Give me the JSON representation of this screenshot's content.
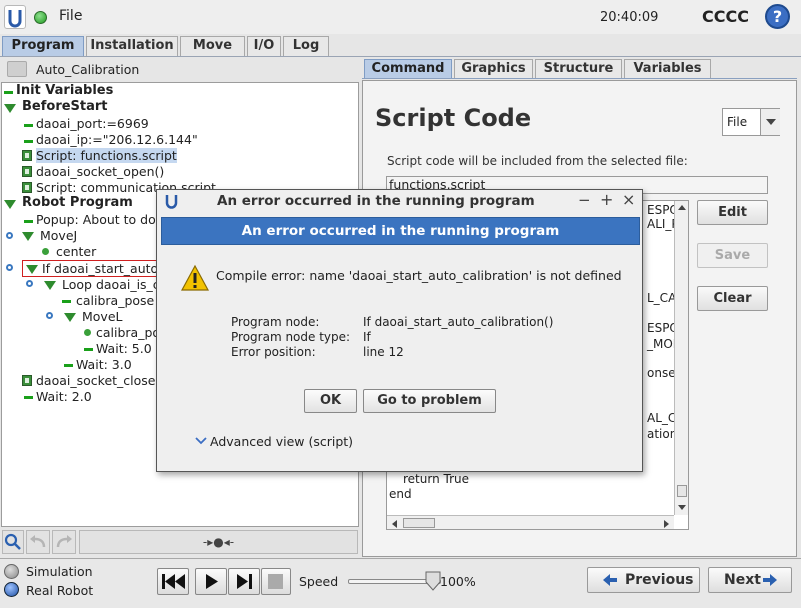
{
  "header": {
    "menu_label": "File",
    "time": "20:40:09",
    "robot_name": "CCCC",
    "help_label": "?"
  },
  "main_tabs": [
    "Program",
    "Installation",
    "Move",
    "I/O",
    "Log"
  ],
  "program_name": "Auto_Calibration",
  "tree": [
    "Init Variables",
    "BeforeStart",
    "daoai_port:=6969",
    "daoai_ip:=\"206.12.6.144\"",
    "Script: functions.script",
    "daoai_socket_open()",
    "Script: communication.script",
    "Robot Program",
    "Popup: About to do",
    "MoveJ",
    "center",
    "If daoai_start_auto",
    "Loop daoai_is_c",
    "calibra_pose",
    "MoveL",
    "calibra_po",
    "Wait: 5.0",
    "Wait: 3.0",
    "daoai_socket_close",
    "Wait: 2.0"
  ],
  "right_tabs": [
    "Command",
    "Graphics",
    "Structure",
    "Variables"
  ],
  "script_panel": {
    "title": "Script Code",
    "mode": "File",
    "info": "Script code will be included from the selected file:",
    "file": "functions.script",
    "code_fragments": [
      "ESPO",
      "ALI_P",
      "L_CA",
      "ESPO",
      "_MOD",
      "onse(",
      "AL_CA",
      "ation",
      "return True",
      "end"
    ],
    "buttons": {
      "edit": "Edit",
      "save": "Save",
      "clear": "Clear"
    }
  },
  "footer": {
    "simulation": "Simulation",
    "real_robot": "Real Robot",
    "speed_label": "Speed",
    "speed_value": "100%",
    "speed_fraction": 1.0,
    "previous": "Previous",
    "next": "Next"
  },
  "dialog": {
    "title": "An error occurred in the running program",
    "heading": "An error occurred in the running program",
    "message": "Compile error: name 'daoai_start_auto_calibration' is not defined",
    "node_label": "Program node:",
    "node_value": "If daoai_start_auto_calibration()",
    "type_label": "Program node type:",
    "type_value": "If",
    "pos_label": "Error position:",
    "pos_value": "line 12",
    "ok": "OK",
    "goto": "Go to problem",
    "advanced": "Advanced view (script)",
    "window_controls": [
      "−",
      "+",
      "×"
    ]
  },
  "tree_toolbar": {
    "center_glyph": "-▸●◂-"
  }
}
